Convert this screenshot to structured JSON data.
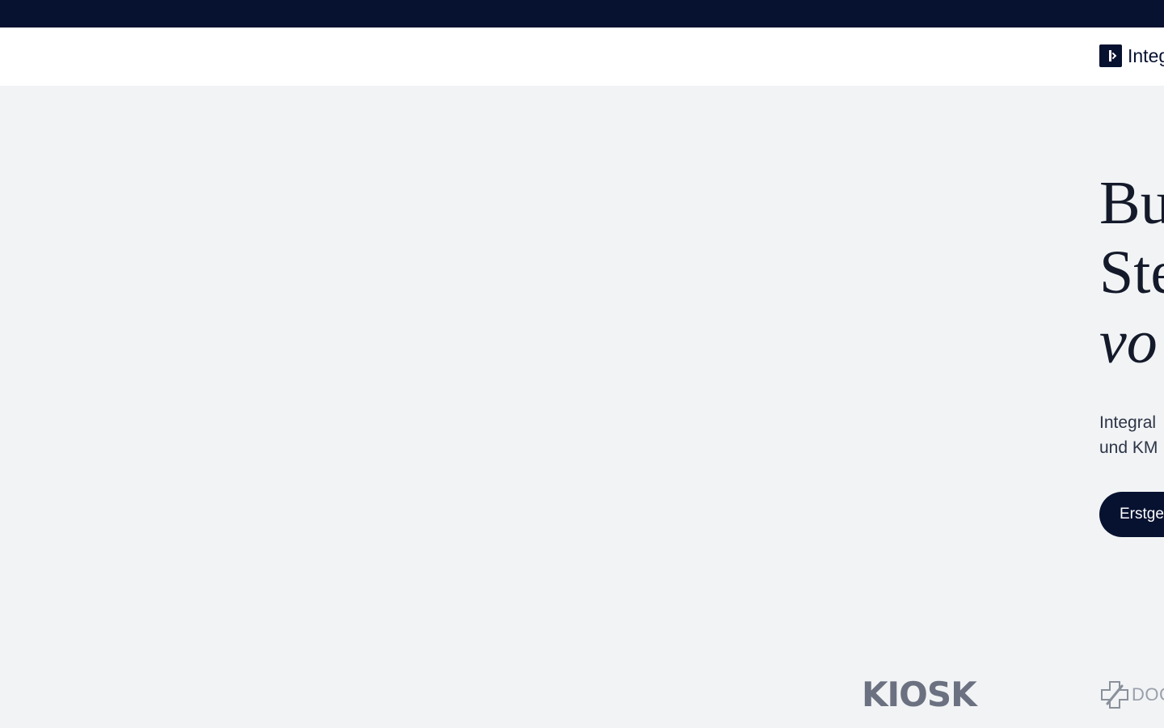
{
  "nav": {
    "brand_name": "Integ"
  },
  "hero": {
    "title_line1": "Bu",
    "title_line2": "Ste",
    "title_line3": "vo",
    "subtitle_line1": "Integral",
    "subtitle_line2": "und KM",
    "cta_label": "Erstge"
  },
  "logos": {
    "kiosk": "KIOSK",
    "doc": "DOC"
  },
  "colors": {
    "navy": "#071130",
    "page_bg": "#f1f3f5",
    "logo_gray": "#6b7180"
  }
}
